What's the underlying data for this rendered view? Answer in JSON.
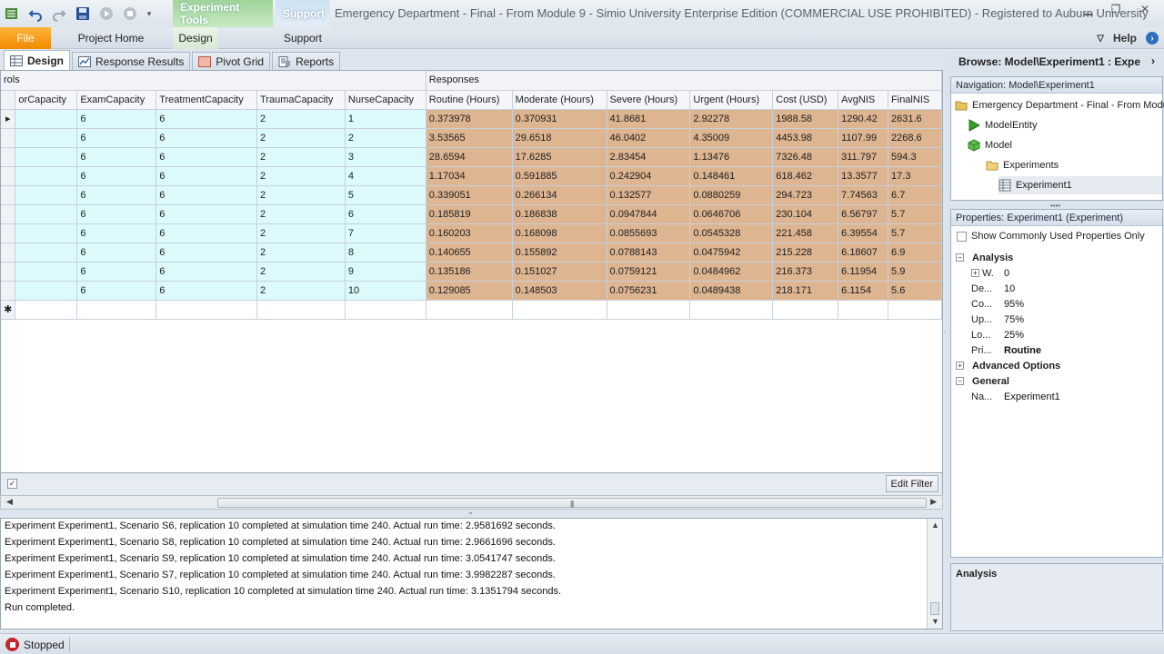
{
  "titlebar": {
    "context_tab_experiment": "Experiment Tools",
    "context_tab_support": "Support",
    "window_title": "Emergency Department - Final - From Module 9 - Simio University Enterprise Edition (COMMERCIAL USE PROHIBITED) - Registered to Auburn University"
  },
  "ribbon": {
    "tabs": [
      "File",
      "Project Home",
      "Design",
      "Support"
    ],
    "help": "Help"
  },
  "doc_tabs": [
    {
      "label": "Design",
      "icon": "design-grid-icon"
    },
    {
      "label": "Response Results",
      "icon": "response-chart-icon"
    },
    {
      "label": "Pivot Grid",
      "icon": "pivot-grid-icon"
    },
    {
      "label": "Reports",
      "icon": "reports-icon"
    }
  ],
  "grid": {
    "group_controls": "rols",
    "group_responses": "Responses",
    "columns": [
      "orCapacity",
      "ExamCapacity",
      "TreatmentCapacity",
      "TraumaCapacity",
      "NurseCapacity",
      "Routine (Hours)",
      "Moderate (Hours)",
      "Severe (Hours)",
      "Urgent (Hours)",
      "Cost (USD)",
      "AvgNIS",
      "FinalNIS"
    ],
    "rows": [
      [
        "",
        "6",
        "6",
        "2",
        "1",
        "0.373978",
        "0.370931",
        "41.8681",
        "2.92278",
        "1988.58",
        "1290.42",
        "2631.6"
      ],
      [
        "",
        "6",
        "6",
        "2",
        "2",
        "3.53565",
        "29.6518",
        "46.0402",
        "4.35009",
        "4453.98",
        "1107.99",
        "2268.6"
      ],
      [
        "",
        "6",
        "6",
        "2",
        "3",
        "28.6594",
        "17.6285",
        "2.83454",
        "1.13476",
        "7326.48",
        "311.797",
        "594.3"
      ],
      [
        "",
        "6",
        "6",
        "2",
        "4",
        "1.17034",
        "0.591885",
        "0.242904",
        "0.148461",
        "618.462",
        "13.3577",
        "17.3"
      ],
      [
        "",
        "6",
        "6",
        "2",
        "5",
        "0.339051",
        "0.266134",
        "0.132577",
        "0.0880259",
        "294.723",
        "7.74563",
        "6.7"
      ],
      [
        "",
        "6",
        "6",
        "2",
        "6",
        "0.185819",
        "0.186838",
        "0.0947844",
        "0.0646706",
        "230.104",
        "6.56797",
        "5.7"
      ],
      [
        "",
        "6",
        "6",
        "2",
        "7",
        "0.160203",
        "0.168098",
        "0.0855693",
        "0.0545328",
        "221.458",
        "6.39554",
        "5.7"
      ],
      [
        "",
        "6",
        "6",
        "2",
        "8",
        "0.140655",
        "0.155892",
        "0.0788143",
        "0.0475942",
        "215.228",
        "6.18607",
        "6.9"
      ],
      [
        "",
        "6",
        "6",
        "2",
        "9",
        "0.135186",
        "0.151027",
        "0.0759121",
        "0.0484962",
        "216.373",
        "6.11954",
        "5.9"
      ],
      [
        "",
        "6",
        "6",
        "2",
        "10",
        "0.129085",
        "0.148503",
        "0.0756231",
        "0.0489438",
        "218.171",
        "6.1154",
        "5.6"
      ]
    ],
    "current_row_marker": "▸",
    "new_row_marker": "✱"
  },
  "filter": {
    "edit_filter": "Edit Filter"
  },
  "log": {
    "lines": [
      "Experiment Experiment1, Scenario S6, replication 10 completed at simulation time 240.  Actual run time: 2.9581692 seconds.",
      "Experiment Experiment1, Scenario S8, replication 10 completed at simulation time 240.  Actual run time: 2.9661696 seconds.",
      "Experiment Experiment1, Scenario S9, replication 10 completed at simulation time 240.  Actual run time: 3.0541747 seconds.",
      "Experiment Experiment1, Scenario S7, replication 10 completed at simulation time 240.  Actual run time: 3.9982287 seconds.",
      "Experiment Experiment1, Scenario S10, replication 10 completed at simulation time 240.  Actual run time: 3.1351794 seconds.",
      "Run completed."
    ]
  },
  "browse": {
    "title": "Browse: Model\\Experiment1 : Expe"
  },
  "navigation": {
    "header": "Navigation: Model\\Experiment1",
    "nodes": [
      {
        "label": "Emergency Department - Final - From Modul",
        "icon": "project-folder-icon"
      },
      {
        "label": "ModelEntity",
        "icon": "entity-triangle-icon"
      },
      {
        "label": "Model",
        "icon": "model-cube-icon"
      },
      {
        "label": "Experiments",
        "icon": "folder-icon"
      },
      {
        "label": "Experiment1",
        "icon": "experiment-table-icon"
      }
    ]
  },
  "properties": {
    "header": "Properties: Experiment1 (Experiment)",
    "show_common": "Show Commonly Used Properties Only",
    "analysis": "Analysis",
    "rows": [
      {
        "name": "W.",
        "value": "0"
      },
      {
        "name": "De...",
        "value": "10"
      },
      {
        "name": "Co...",
        "value": "95%"
      },
      {
        "name": "Up...",
        "value": "75%"
      },
      {
        "name": "Lo...",
        "value": "25%"
      },
      {
        "name": "Pri...",
        "value": "Routine"
      }
    ],
    "advanced": "Advanced Options",
    "general": "General",
    "name_row": {
      "name": "Na...",
      "value": "Experiment1"
    }
  },
  "description": {
    "title": "Analysis"
  },
  "status": {
    "text": "Stopped"
  },
  "colors": {
    "control_cell": "#dcfafc",
    "response_cell": "#deb591",
    "file_tab": "#f08a00",
    "stop": "#c8242a"
  }
}
